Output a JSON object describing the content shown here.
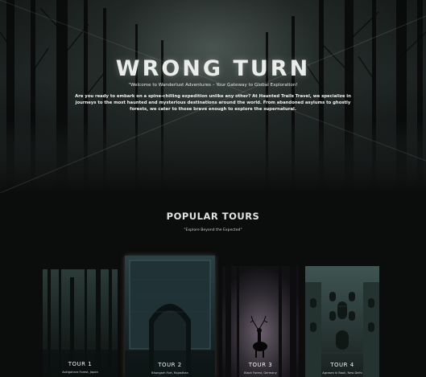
{
  "hero": {
    "title": "WRONG TURN",
    "tagline": "\"Welcome to Wanderlust Adventures – Your Gateway to Global Exploration!",
    "description": "Are you ready to embark on a spine-chilling expedition unlike any other? At Haunted Trails Travel, we specialize in journeys to the most haunted and mysterious destinations around the world. From abandoned asylums to ghostly forests, we cater to those brave enough to explore the supernatural."
  },
  "popular": {
    "title": "POPULAR TOURS",
    "subtitle": "\"Explore Beyond the Expected\""
  },
  "tours": [
    {
      "label": "TOUR 1",
      "location": "Aokigahara Forest, Japan"
    },
    {
      "label": "TOUR 2",
      "location": "Bhangarh Fort, Rajasthan"
    },
    {
      "label": "TOUR 3",
      "location": "Black Forest, Germany"
    },
    {
      "label": "TOUR 4",
      "location": "Agrasen ki Baoli, New Delhi"
    }
  ],
  "colors": {
    "background": "#0b0c0c",
    "heading": "#e2e2e2",
    "hero_glow": "#a0b4aa"
  }
}
